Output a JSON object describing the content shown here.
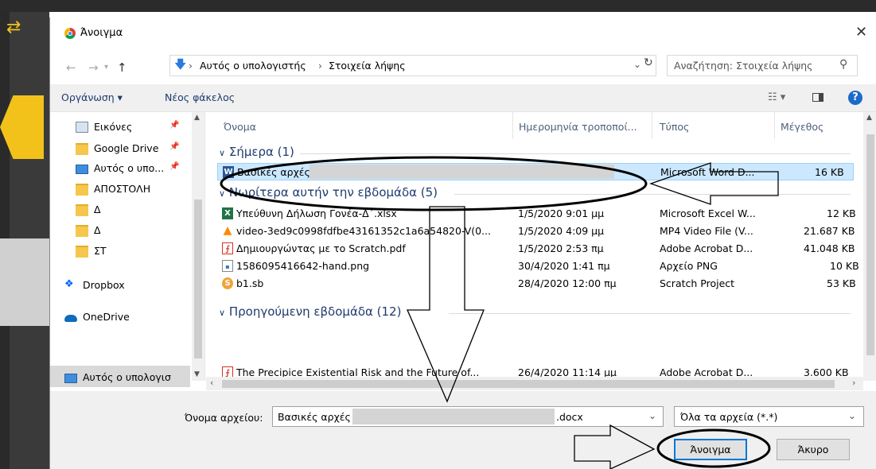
{
  "app": {
    "icon": "swap-arrows-icon"
  },
  "dialog": {
    "title": "Άνοιγμα",
    "close": "✕"
  },
  "nav": {
    "back": "←",
    "forward": "→",
    "up": "↑",
    "breadcrumb": [
      "Αυτός ο υπολογιστής",
      "Στοιχεία λήψης"
    ],
    "separator": "›",
    "search_placeholder": "Αναζήτηση: Στοιχεία λήψης"
  },
  "toolbar": {
    "organize": "Οργάνωση ▾",
    "new_folder": "Νέος φάκελος",
    "help": "?"
  },
  "sidebar": {
    "items": [
      {
        "label": "Εικόνες",
        "icon": "pictures-icon",
        "pinned": true
      },
      {
        "label": "Google Drive",
        "icon": "folder-icon",
        "pinned": true
      },
      {
        "label": "Αυτός ο υπο...",
        "icon": "computer-icon",
        "pinned": true
      },
      {
        "label": "ΑΠΟΣΤΟΛΗ",
        "icon": "folder-icon"
      },
      {
        "label": "Δ",
        "icon": "folder-icon"
      },
      {
        "label": "Δ",
        "icon": "folder-icon"
      },
      {
        "label": "ΣΤ",
        "icon": "folder-icon"
      },
      {
        "label": "Dropbox",
        "icon": "dropbox-icon"
      },
      {
        "label": "OneDrive",
        "icon": "onedrive-icon"
      },
      {
        "label": "Αυτός ο υπολογισ",
        "icon": "computer-icon"
      }
    ]
  },
  "columns": {
    "name": "Όνομα",
    "date": "Ημερομηνία τροποποί...",
    "type": "Τύπος",
    "size": "Μέγεθος"
  },
  "groups": [
    {
      "label": "Σήμερα (1)"
    },
    {
      "label": "Νωρίτερα αυτήν την εβδομάδα (5)"
    },
    {
      "label": "Προηγούμενη εβδομάδα (12)"
    }
  ],
  "files": [
    {
      "name": "Βασικές αρχές",
      "date": "",
      "type": "Microsoft Word D...",
      "size": "16 KB",
      "icon": "word-icon",
      "selected": true
    },
    {
      "name": "Υπεύθυνη Δήλωση Γονέα-Δ΄.xlsx",
      "date": "1/5/2020 9:01 μμ",
      "type": "Microsoft Excel W...",
      "size": "12 KB",
      "icon": "excel-icon"
    },
    {
      "name": "video-3ed9c0998fdfbe43161352c1a6a54820-V(0...",
      "date": "1/5/2020 4:09 μμ",
      "type": "MP4 Video File (V...",
      "size": "21.687 KB",
      "icon": "vlc-icon"
    },
    {
      "name": "Δημιουργώντας με το Scratch.pdf",
      "date": "1/5/2020 2:53 πμ",
      "type": "Adobe Acrobat D...",
      "size": "41.048 KB",
      "icon": "pdf-icon"
    },
    {
      "name": "1586095416642-hand.png",
      "date": "30/4/2020 1:41 πμ",
      "type": "Αρχείο PNG",
      "size": "10 KB",
      "icon": "image-file-icon"
    },
    {
      "name": "b1.sb",
      "date": "28/4/2020 12:00 πμ",
      "type": "Scratch Project",
      "size": "53 KB",
      "icon": "scratch-icon"
    },
    {
      "name": "The Precipice Existential Risk and the Future of...",
      "date": "26/4/2020 11:14 μμ",
      "type": "Adobe Acrobat D...",
      "size": "3.600 KB",
      "icon": "pdf-icon"
    }
  ],
  "footer": {
    "filename_label": "Όνομα αρχείου:",
    "filename_value": "Βασικές αρχές",
    "filename_ext": ".docx",
    "filetype_value": "Όλα τα αρχεία (*.*)",
    "open": "Άνοιγμα",
    "cancel": "Άκυρο"
  },
  "colors": {
    "accent": "#0078d7",
    "selection": "#cce8ff",
    "group_text": "#1e3b6e"
  }
}
